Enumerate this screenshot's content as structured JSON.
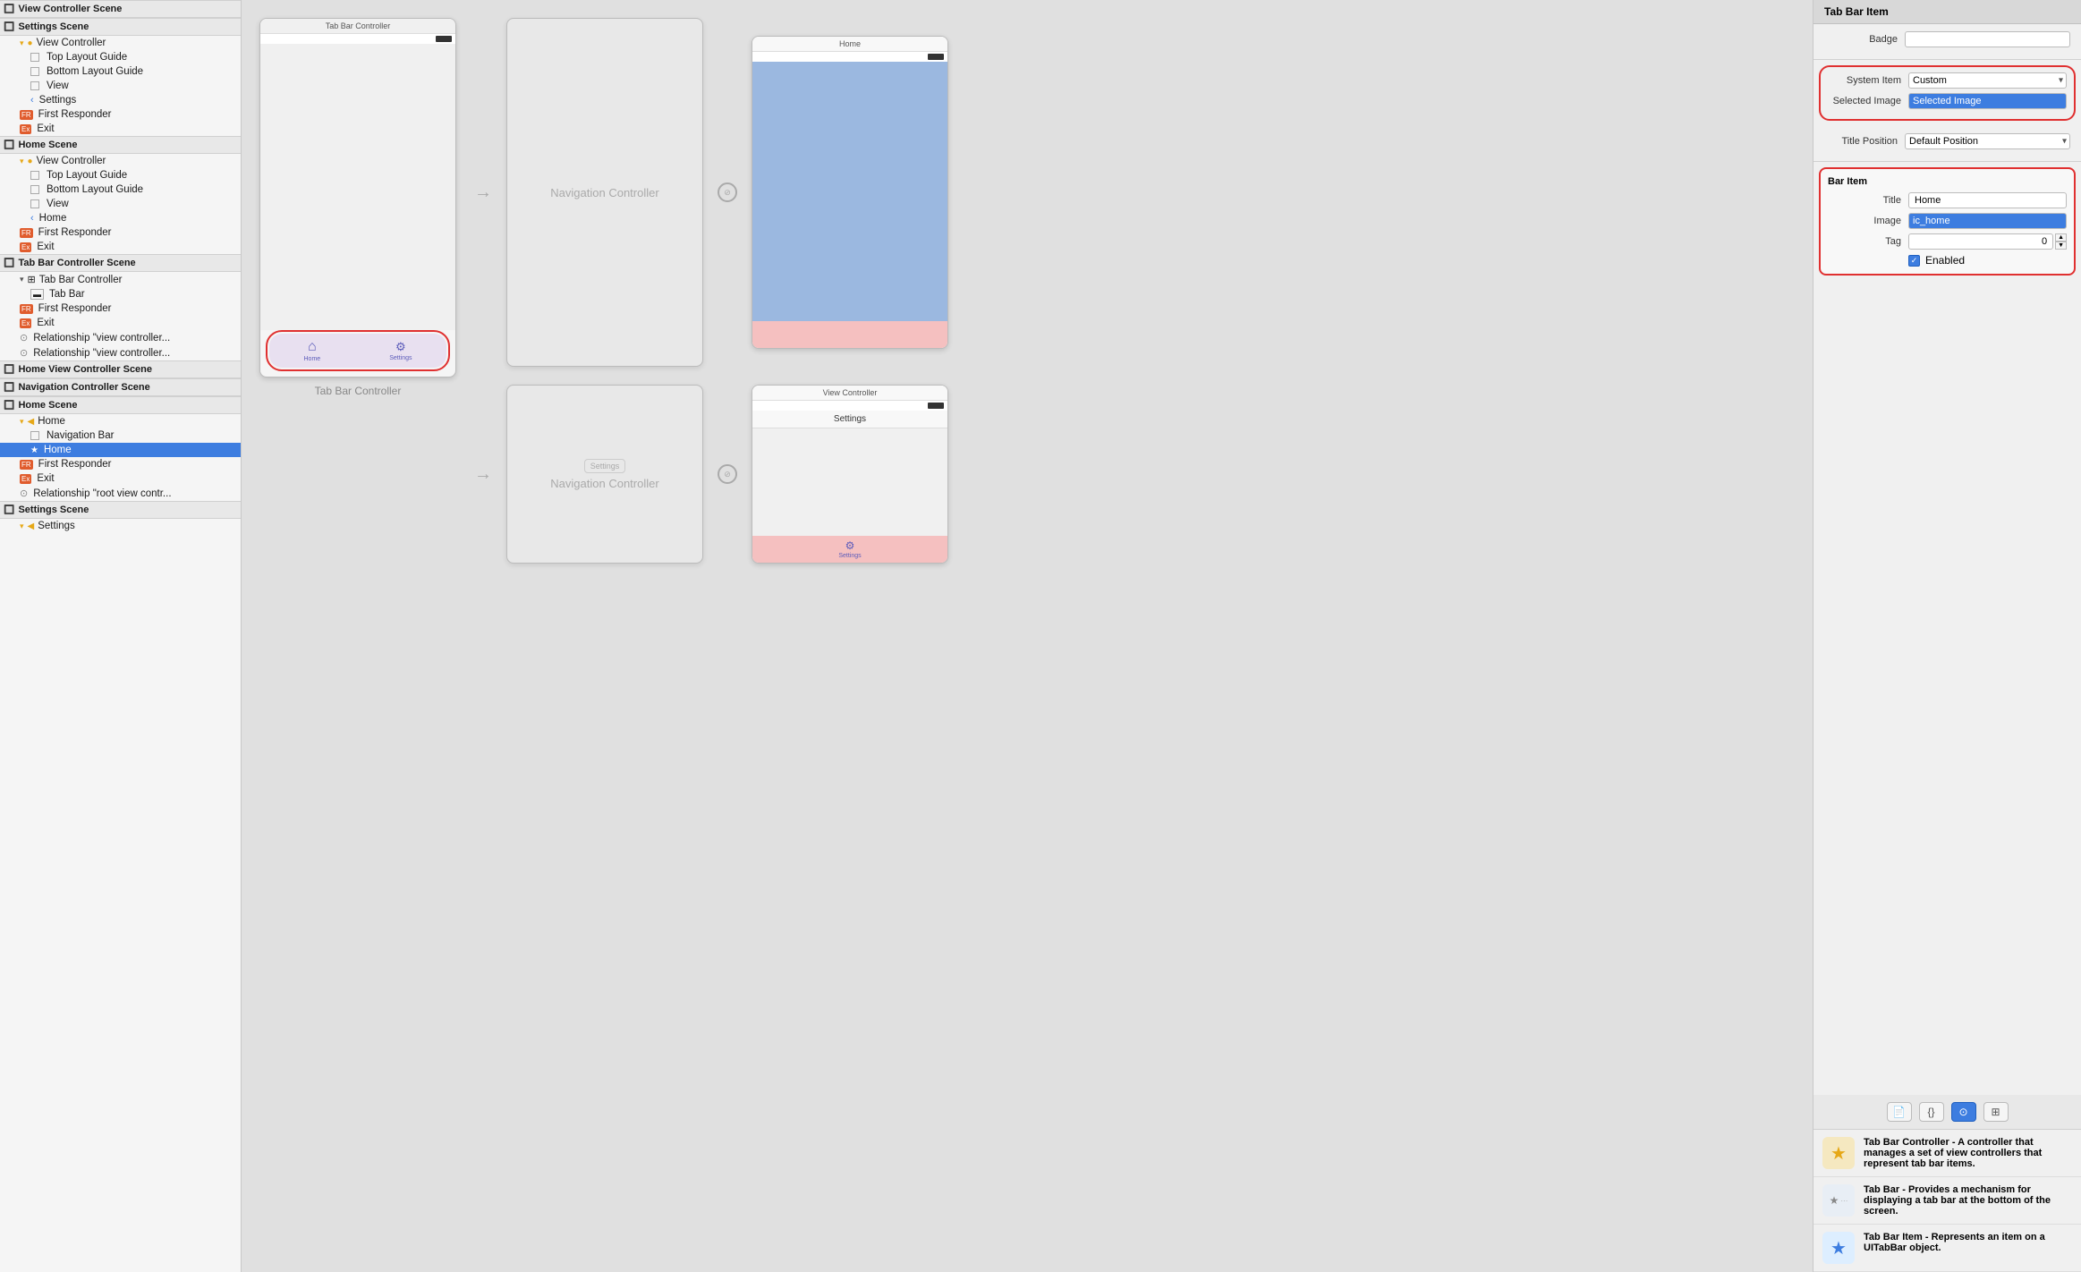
{
  "sidebar": {
    "scenes": [
      {
        "name": "View Controller Scene",
        "icon": "🔲",
        "children": []
      },
      {
        "name": "Settings Scene",
        "icon": "🔲",
        "children": [
          {
            "label": "View Controller",
            "indent": 1,
            "arrow": true,
            "iconType": "yellow-circle"
          },
          {
            "label": "Top Layout Guide",
            "indent": 2,
            "iconType": "rect"
          },
          {
            "label": "Bottom Layout Guide",
            "indent": 2,
            "iconType": "rect"
          },
          {
            "label": "View",
            "indent": 2,
            "iconType": "rect"
          },
          {
            "label": "Settings",
            "indent": 2,
            "iconType": "back-arrow"
          },
          {
            "label": "First Responder",
            "indent": 1,
            "iconType": "orange-rect"
          },
          {
            "label": "Exit",
            "indent": 1,
            "iconType": "orange-rect"
          }
        ]
      },
      {
        "name": "Home Scene",
        "icon": "🔲",
        "children": [
          {
            "label": "View Controller",
            "indent": 1,
            "arrow": true,
            "iconType": "yellow-circle"
          },
          {
            "label": "Top Layout Guide",
            "indent": 2,
            "iconType": "rect"
          },
          {
            "label": "Bottom Layout Guide",
            "indent": 2,
            "iconType": "rect"
          },
          {
            "label": "View",
            "indent": 2,
            "iconType": "rect"
          },
          {
            "label": "Home",
            "indent": 2,
            "iconType": "back-arrow"
          },
          {
            "label": "First Responder",
            "indent": 1,
            "iconType": "orange-rect"
          },
          {
            "label": "Exit",
            "indent": 1,
            "iconType": "orange-rect"
          }
        ]
      },
      {
        "name": "Tab Bar Controller Scene",
        "icon": "🔲",
        "children": [
          {
            "label": "Tab Bar Controller",
            "indent": 1,
            "arrow": true,
            "iconType": "tab-bar-ctrl"
          },
          {
            "label": "Tab Bar",
            "indent": 2,
            "iconType": "tab-bar"
          },
          {
            "label": "First Responder",
            "indent": 1,
            "iconType": "orange-rect"
          },
          {
            "label": "Exit",
            "indent": 1,
            "iconType": "orange-rect"
          },
          {
            "label": "Relationship \"view controller...",
            "indent": 1,
            "iconType": "circle-arrow"
          },
          {
            "label": "Relationship \"view controller...",
            "indent": 1,
            "iconType": "circle-arrow"
          }
        ]
      },
      {
        "name": "Home View Controller Scene",
        "icon": "🔲",
        "children": []
      },
      {
        "name": "Navigation Controller Scene",
        "icon": "🔲",
        "children": []
      },
      {
        "name": "Home Scene",
        "icon": "🔲",
        "children": [
          {
            "label": "Home",
            "indent": 1,
            "arrow": true,
            "iconType": "yellow-circle-back"
          },
          {
            "label": "Navigation Bar",
            "indent": 2,
            "iconType": "rect"
          },
          {
            "label": "Home",
            "indent": 2,
            "iconType": "star",
            "selected": true
          },
          {
            "label": "First Responder",
            "indent": 1,
            "iconType": "orange-rect"
          },
          {
            "label": "Exit",
            "indent": 1,
            "iconType": "orange-rect"
          },
          {
            "label": "Relationship \"root view contr...",
            "indent": 1,
            "iconType": "circle-arrow"
          }
        ]
      },
      {
        "name": "Settings Scene",
        "icon": "🔲",
        "children": [
          {
            "label": "Settings",
            "indent": 1,
            "arrow": true,
            "iconType": "yellow-circle-back"
          }
        ]
      }
    ]
  },
  "canvas": {
    "tabBarController": {
      "label": "Tab Bar Controller",
      "tabItems": [
        {
          "icon": "⌂",
          "label": "Home"
        },
        {
          "icon": "⚙",
          "label": "Settings"
        }
      ]
    },
    "navigationController1": {
      "label": "Navigation Controller"
    },
    "navigationController2": {
      "label": "Navigation Controller"
    },
    "homePhone": {
      "title": "Home",
      "statusBar": "■■■"
    },
    "settingsPhone": {
      "title": "Settings",
      "statusBar": "■■■"
    },
    "viewController": {
      "title": "View Controller"
    }
  },
  "rightPanel": {
    "title": "Tab Bar Item",
    "badgeLabel": "Badge",
    "systemItemLabel": "System Item",
    "systemItemValue": "Custom",
    "selectedImageLabel": "Selected Image",
    "selectedImageValue": "Selected Image",
    "titlePositionLabel": "Title Position",
    "titlePositionValue": "Default Position",
    "barItemTitle": "Bar Item",
    "barItemTitleLabel": "Title",
    "barItemTitleValue": "Home",
    "barItemImageLabel": "Image",
    "barItemImageValue": "ic_home",
    "barItemTagLabel": "Tag",
    "barItemTagValue": "0",
    "barItemEnabledLabel": "Enabled",
    "barItemEnabledChecked": true,
    "inspectorTabs": [
      "📄",
      "{}",
      "⊙",
      "⊞"
    ],
    "objectLibrary": [
      {
        "iconColor": "#e6a817",
        "iconChar": "★",
        "title": "Tab Bar Controller",
        "desc": "A controller that manages a set of view controllers that represent tab bar items."
      },
      {
        "iconColor": "#6699cc",
        "iconChar": "★",
        "title": "Tab Bar",
        "desc": "Provides a mechanism for displaying a tab bar at the bottom of the screen."
      },
      {
        "iconColor": "#3d7de0",
        "iconChar": "★",
        "title": "Tab Bar Item",
        "desc": "Represents an item on a UITabBar object."
      }
    ]
  }
}
